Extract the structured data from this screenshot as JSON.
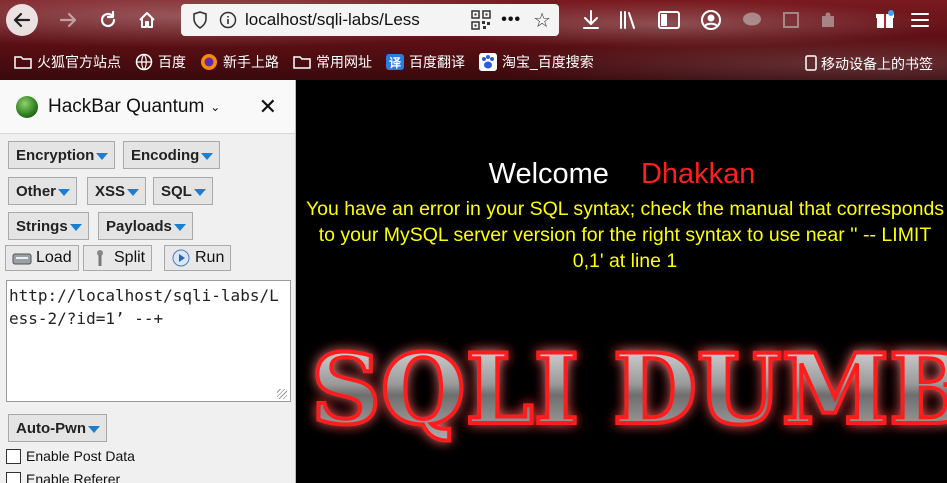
{
  "browser": {
    "url": "localhost/sqli-labs/Less",
    "more_label": "•••"
  },
  "bookmarks": [
    {
      "label": "火狐官方站点",
      "icon": "folder-icon"
    },
    {
      "label": "百度",
      "icon": "globe-icon"
    },
    {
      "label": "新手上路",
      "icon": "firefox-icon"
    },
    {
      "label": "常用网址",
      "icon": "folder-icon"
    },
    {
      "label": "百度翻译",
      "icon": "translate-icon"
    },
    {
      "label": "淘宝_百度搜索",
      "icon": "baidu-paw-icon"
    }
  ],
  "bookmarks_right": {
    "label": "移动设备上的书签",
    "icon": "mobile-bookmark-icon"
  },
  "hackbar": {
    "title": "HackBar Quantum",
    "menus": [
      "Encryption",
      "Encoding",
      "Other",
      "XSS",
      "SQL",
      "Strings",
      "Payloads"
    ],
    "actions": [
      "Load",
      "Split",
      "Run"
    ],
    "url_value": "http://localhost/sqli-labs/Less-2/?id=1’ --+",
    "auto_pwn": "Auto-Pwn",
    "checkboxes": [
      "Enable Post Data",
      "Enable Referer"
    ]
  },
  "page": {
    "welcome": "Welcome",
    "user": "Dhakkan",
    "error": "You have an error in your SQL syntax; check the manual that corresponds to your MySQL server version for the right syntax to use near '' -- LIMIT 0,1' at line 1",
    "logo_text": "SQLI DUMB"
  },
  "colors": {
    "welcome_text": "#ffffff",
    "user_text": "#ff1f1f",
    "error_text": "#ffff00",
    "dropdown_arrow": "#1a7fd0"
  }
}
